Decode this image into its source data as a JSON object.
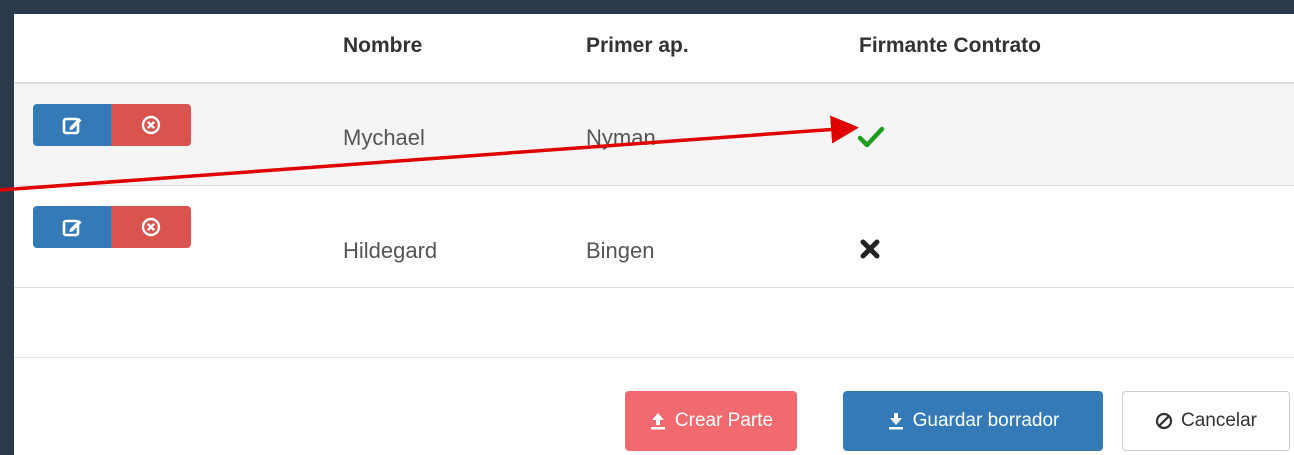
{
  "table": {
    "headers": {
      "name": "Nombre",
      "surname": "Primer ap.",
      "signer": "Firmante Contrato"
    },
    "rows": [
      {
        "name": "Mychael",
        "surname": "Nyman",
        "signer": "check"
      },
      {
        "name": "Hildegard",
        "surname": "Bingen",
        "signer": "cross"
      }
    ]
  },
  "footer": {
    "crear_label": "Crear Parte",
    "guardar_label": "Guardar borrador",
    "cancelar_label": "Cancelar"
  },
  "colors": {
    "edit": "#337ab7",
    "delete": "#d9534f",
    "crear": "#f06a6f",
    "check": "#1f9d1f",
    "arrow": "#e00000"
  }
}
